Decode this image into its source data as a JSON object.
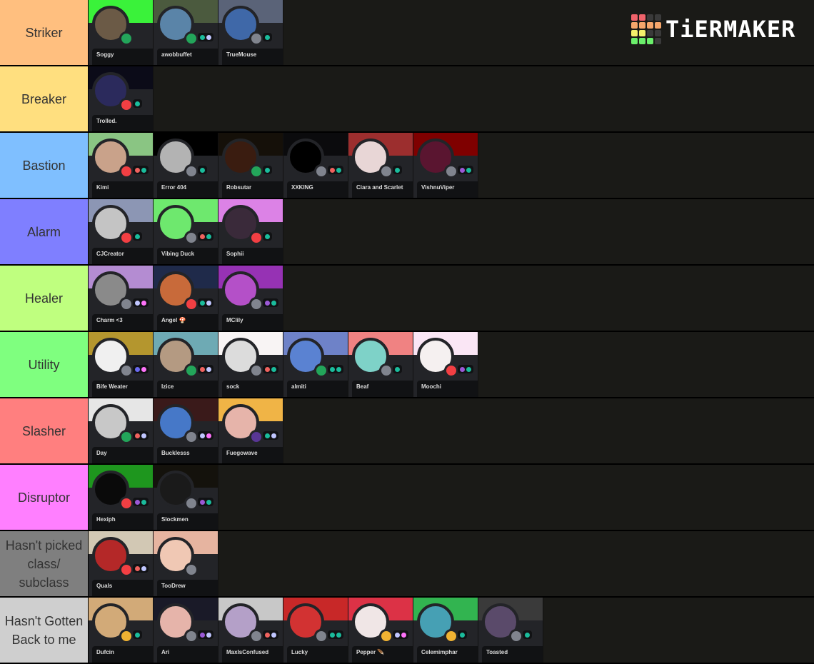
{
  "logo": {
    "text": "TiERMAKER",
    "grid_colors": [
      "#f0636b",
      "#f0636b",
      "#3a3a3a",
      "#3a3a3a",
      "#f5a66b",
      "#f5a66b",
      "#f5a66b",
      "#f5a66b",
      "#f4f06b",
      "#f4f06b",
      "#3a3a3a",
      "#3a3a3a",
      "#6bef6b",
      "#6bef6b",
      "#6bef6b",
      "#3a3a3a"
    ]
  },
  "tiers": [
    {
      "label": "Striker",
      "color": "#ffbf7f",
      "items": [
        {
          "name": "Soggy",
          "banner": "#3af23a",
          "avatar": "#6b5a46",
          "status": "#23a55a",
          "badges": []
        },
        {
          "name": "awobbuffet",
          "banner": "#4b5a3e",
          "avatar": "#5a84a8",
          "status": "#23a55a",
          "badges": [
            "#1abc9c",
            "#c0c6ff"
          ]
        },
        {
          "name": "TrueMouse",
          "banner": "#5a6378",
          "avatar": "#3f68a8",
          "status": "#80848e",
          "badges": [
            "#1abc9c"
          ]
        }
      ]
    },
    {
      "label": "Breaker",
      "color": "#ffdf7f",
      "items": [
        {
          "name": "Trolled.",
          "banner": "#0b0b18",
          "avatar": "#2b2a5c",
          "status": "#f23f43",
          "badges": [
            "#1abc9c"
          ]
        }
      ]
    },
    {
      "label": "Bastion",
      "color": "#7fbfff",
      "items": [
        {
          "name": "Kimi",
          "banner": "#8ac583",
          "avatar": "#c9a28a",
          "status": "#f23f43",
          "badges": [
            "#f0625e",
            "#1abc9c"
          ]
        },
        {
          "name": "Error 404",
          "banner": "#000000",
          "avatar": "#b3b3b3",
          "status": "#80848e",
          "badges": [
            "#1abc9c"
          ]
        },
        {
          "name": "Robsutar",
          "banner": "#151009",
          "avatar": "#3a1c10",
          "status": "#23a55a",
          "badges": [
            "#1abc9c"
          ]
        },
        {
          "name": "XXKING",
          "banner": "#0b0b0d",
          "avatar": "#000000",
          "status": "#80848e",
          "badges": [
            "#f0625e",
            "#1abc9c"
          ]
        },
        {
          "name": "Ciara and Scarlet",
          "banner": "#9c2e2e",
          "avatar": "#e8d6d6",
          "status": "#80848e",
          "badges": [
            "#1abc9c"
          ]
        },
        {
          "name": "VishnuViper",
          "banner": "#7f0000",
          "avatar": "#5a1530",
          "status": "#80848e",
          "badges": [
            "#9b59d6",
            "#1abc9c"
          ]
        }
      ]
    },
    {
      "label": "Alarm",
      "color": "#7f7fff",
      "items": [
        {
          "name": "CJCreator",
          "banner": "#8c96b4",
          "avatar": "#c4c4c4",
          "status": "#f23f43",
          "badges": [
            "#1abc9c"
          ]
        },
        {
          "name": "Vibing Duck",
          "banner": "#6ee86e",
          "avatar": "#6ee86e",
          "status": "#80848e",
          "badges": [
            "#f0625e",
            "#1abc9c"
          ]
        },
        {
          "name": "Sophii",
          "banner": "#dc82e6",
          "avatar": "#3a2a3a",
          "status": "#f23f43",
          "badges": [
            "#1abc9c"
          ]
        }
      ]
    },
    {
      "label": "Healer",
      "color": "#bfff7f",
      "items": [
        {
          "name": "Charm <3",
          "banner": "#b48cd2",
          "avatar": "#8a8a8a",
          "status": "#80848e",
          "badges": [
            "#c0c6ff",
            "#ff73fa"
          ]
        },
        {
          "name": "Angel 🍄",
          "banner": "#1f2a4a",
          "avatar": "#c86a3a",
          "status": "#f23f43",
          "badges": [
            "#1abc9c",
            "#c0c6ff"
          ]
        },
        {
          "name": "MClily",
          "banner": "#9632b4",
          "avatar": "#b450c8",
          "status": "#80848e",
          "badges": [
            "#9b59d6",
            "#1abc9c"
          ]
        }
      ]
    },
    {
      "label": "Utility",
      "color": "#7fff7f",
      "items": [
        {
          "name": "Bife Weater",
          "banner": "#b4962e",
          "avatar": "#f0f0f0",
          "status": "#80848e",
          "badges": [
            "#6a6af0",
            "#ff73fa"
          ]
        },
        {
          "name": "Izice",
          "banner": "#6eaab4",
          "avatar": "#b49a82",
          "status": "#23a55a",
          "badges": [
            "#f0625e",
            "#c0c6ff"
          ]
        },
        {
          "name": "sock",
          "banner": "#f8f4f4",
          "avatar": "#dcdcdc",
          "status": "#80848e",
          "badges": [
            "#f0625e",
            "#1abc9c"
          ]
        },
        {
          "name": "almiti",
          "banner": "#6e82c8",
          "avatar": "#5a82d2",
          "status": "#23a55a",
          "badges": [
            "#1abc9c",
            "#1abc9c"
          ]
        },
        {
          "name": "Beaf",
          "banner": "#f08282",
          "avatar": "#7ed2c8",
          "status": "#80848e",
          "badges": [
            "#1abc9c"
          ]
        },
        {
          "name": "Moochi",
          "banner": "#fae6f5",
          "avatar": "#f5f0f0",
          "status": "#f23f43",
          "badges": [
            "#9b59d6",
            "#1abc9c"
          ]
        }
      ]
    },
    {
      "label": "Slasher",
      "color": "#ff7f7f",
      "items": [
        {
          "name": "Day",
          "banner": "#e6e6e6",
          "avatar": "#c8c8c8",
          "status": "#23a55a",
          "badges": [
            "#f0625e",
            "#c0c6ff"
          ]
        },
        {
          "name": "Bucklesss",
          "banner": "#3a1a1a",
          "avatar": "#4678c8",
          "status": "#80848e",
          "badges": [
            "#c0c6ff",
            "#ff73fa"
          ]
        },
        {
          "name": "Fuegowave",
          "banner": "#f0b446",
          "avatar": "#e6b4aa",
          "status": "#593695",
          "badges": [
            "#1abc9c",
            "#c0c6ff"
          ]
        }
      ]
    },
    {
      "label": "Disruptor",
      "color": "#ff7fff",
      "items": [
        {
          "name": "Hexiph",
          "banner": "#1e961e",
          "avatar": "#0a0a0a",
          "status": "#f23f43",
          "badges": [
            "#9b59d6",
            "#1abc9c"
          ]
        },
        {
          "name": "Slockmen",
          "banner": "#14120c",
          "avatar": "#1a1a1a",
          "status": "#80848e",
          "badges": [
            "#9b59d6",
            "#1abc9c"
          ]
        }
      ]
    },
    {
      "label": "Hasn't picked class/ subclass",
      "color": "#7f7f7f",
      "items": [
        {
          "name": "Quals",
          "banner": "#d2c8b4",
          "avatar": "#b42828",
          "status": "#f23f43",
          "badges": [
            "#f0625e",
            "#c0c6ff"
          ]
        },
        {
          "name": "TooDrew",
          "banner": "#e6b4a0",
          "avatar": "#f0c8b4",
          "status": "#80848e",
          "badges": []
        }
      ]
    },
    {
      "label": "Hasn't Gotten Back to me",
      "color": "#cfcfcf",
      "items": [
        {
          "name": "Dufcin",
          "banner": "#d2aa78",
          "avatar": "#d2aa78",
          "status": "#f0b232",
          "badges": [
            "#1abc9c"
          ]
        },
        {
          "name": "Ari",
          "banner": "#1a1a28",
          "avatar": "#e6b4aa",
          "status": "#80848e",
          "badges": [
            "#9b59d6",
            "#c0c6ff"
          ]
        },
        {
          "name": "MaxIsConfused",
          "banner": "#c8c8c8",
          "avatar": "#b4a0c8",
          "status": "#80848e",
          "badges": [
            "#f0625e",
            "#c0c6ff"
          ]
        },
        {
          "name": "Lucky",
          "banner": "#c82828",
          "avatar": "#d23232",
          "status": "#80848e",
          "badges": [
            "#1abc9c",
            "#1abc9c"
          ]
        },
        {
          "name": "Pepper 🪶",
          "banner": "#dc3246",
          "avatar": "#f0e6e6",
          "status": "#f0b232",
          "badges": [
            "#c0c6ff",
            "#ff73fa"
          ]
        },
        {
          "name": "Celemimphar",
          "banner": "#32b450",
          "avatar": "#46a0b4",
          "status": "#f0b232",
          "badges": [
            "#1abc9c"
          ]
        },
        {
          "name": "Toasted",
          "banner": "#3a3a3a",
          "avatar": "#5a4a6a",
          "status": "#80848e",
          "badges": [
            "#1abc9c"
          ]
        }
      ]
    }
  ]
}
